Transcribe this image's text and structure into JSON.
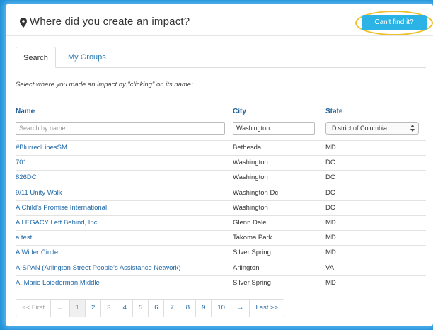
{
  "header": {
    "title": "Where did you create an impact?",
    "cant_find_label": "Can't find it?"
  },
  "tabs": [
    {
      "label": "Search",
      "active": true
    },
    {
      "label": "My Groups",
      "active": false
    }
  ],
  "instruction": "Select where you made an impact by \"clicking\" on its name:",
  "table": {
    "columns": [
      "Name",
      "City",
      "State"
    ],
    "filters": {
      "name_placeholder": "Search by name",
      "city_value": "Washington",
      "state_selected": "District of Columbia"
    },
    "rows": [
      {
        "name": "#BlurredLinesSM",
        "city": "Bethesda",
        "state": "MD"
      },
      {
        "name": "701",
        "city": "Washington",
        "state": "DC"
      },
      {
        "name": "826DC",
        "city": "Washington",
        "state": "DC"
      },
      {
        "name": "9/11 Unity Walk",
        "city": "Washington Dc",
        "state": "DC"
      },
      {
        "name": "A Child's Promise International",
        "city": "Washington",
        "state": "DC"
      },
      {
        "name": "A LEGACY Left Behind, Inc.",
        "city": "Glenn Dale",
        "state": "MD"
      },
      {
        "name": "a test",
        "city": "Takoma Park",
        "state": "MD"
      },
      {
        "name": "A Wider Circle",
        "city": "Silver Spring",
        "state": "MD"
      },
      {
        "name": "A-SPAN (Arlington Street People's Assistance Network)",
        "city": "Arlington",
        "state": "VA"
      },
      {
        "name": "A. Mario Loiederman Middle",
        "city": "Silver Spring",
        "state": "MD"
      }
    ]
  },
  "pagination": {
    "first": "<< First",
    "prev": "←",
    "pages": [
      "1",
      "2",
      "3",
      "4",
      "5",
      "6",
      "7",
      "8",
      "9",
      "10"
    ],
    "current": "1",
    "next": "→",
    "last": "Last >>"
  },
  "colors": {
    "accent": "#2ab3e4",
    "link": "#1f67a6",
    "highlight": "#f0c02b",
    "background": "#1e8fd6"
  }
}
